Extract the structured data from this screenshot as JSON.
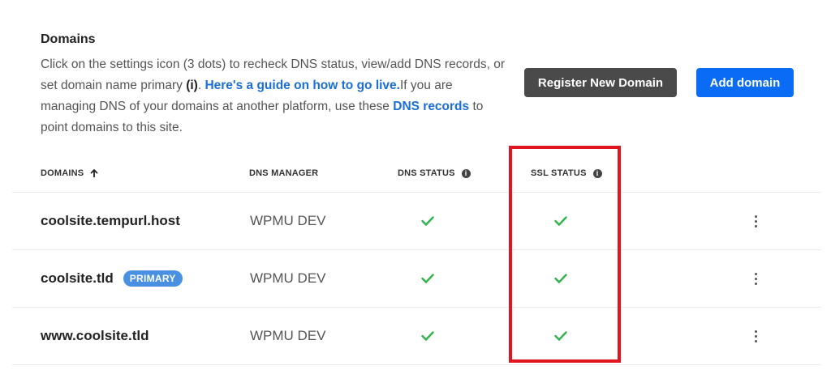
{
  "header": {
    "title": "Domains",
    "desc_part1": "Click on the settings icon (3 dots) to recheck DNS status, view/add DNS records, or set domain name primary ",
    "desc_bold": "(i)",
    "desc_part2": ". ",
    "guide_link": "Here's a guide on how to go live.",
    "desc_part3": "If you are managing DNS of your domains at another platform, use these ",
    "dns_records_link": "DNS records",
    "desc_part4": " to point domains to this site."
  },
  "buttons": {
    "register": "Register New Domain",
    "add": "Add domain"
  },
  "table": {
    "columns": {
      "domains": "DOMAINS",
      "dns_manager": "DNS MANAGER",
      "dns_status": "DNS STATUS",
      "ssl_status": "SSL STATUS"
    },
    "sort": "ascending",
    "rows": [
      {
        "domain": "coolsite.tempurl.host",
        "badge": "",
        "manager": "WPMU DEV",
        "dns_status": "ok",
        "ssl_status": "ok"
      },
      {
        "domain": "coolsite.tld",
        "badge": "PRIMARY",
        "manager": "WPMU DEV",
        "dns_status": "ok",
        "ssl_status": "ok"
      },
      {
        "domain": "www.coolsite.tld",
        "badge": "",
        "manager": "WPMU DEV",
        "dns_status": "ok",
        "ssl_status": "ok"
      }
    ]
  },
  "colors": {
    "check": "#2fb34a",
    "highlight": "#e0151f",
    "primary_button": "#0a6cf5",
    "secondary_button": "#4a4a4a",
    "badge": "#4a90e2",
    "link": "#1a6ed6"
  },
  "icons": {
    "sort": "arrow-up-icon",
    "info": "info-icon",
    "status": "check-icon",
    "menu": "more-vertical-icon"
  }
}
